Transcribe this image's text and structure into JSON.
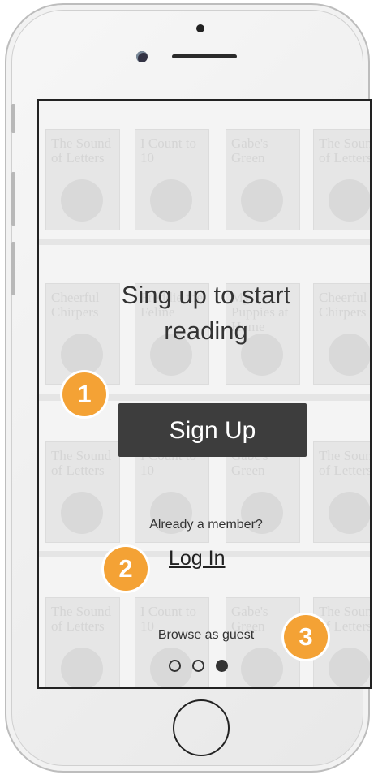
{
  "headline": {
    "line1": "Sing up to start",
    "line2": "reading"
  },
  "signup_label": "Sign Up",
  "already_member_label": "Already a member?",
  "login_label": "Log In",
  "guest_label": "Browse as guest",
  "badges": [
    "1",
    "2",
    "3"
  ],
  "pager": {
    "count": 3,
    "active_index": 2
  },
  "books": [
    "The Sound of Letters",
    "I Count to 10",
    "Gabe's Green",
    "Cheerful Chirpers",
    "Freddie the Feline",
    "My Puppies at Home"
  ],
  "colors": {
    "badge": "#f4a235",
    "button": "#3d3d3d",
    "text": "#333333"
  }
}
